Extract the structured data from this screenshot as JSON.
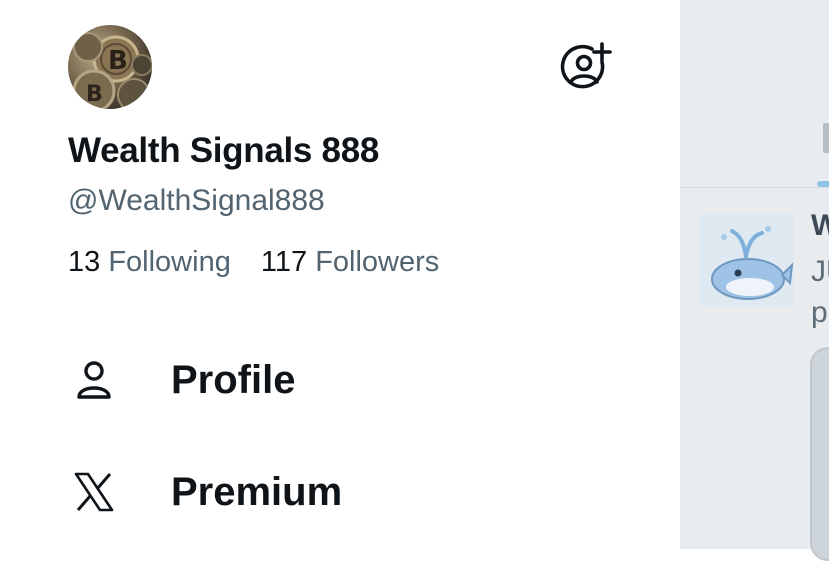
{
  "account": {
    "display_name": "Wealth Signals 888",
    "handle": "@WealthSignal888",
    "avatar_icon": "bitcoin-coins-avatar",
    "add_account_icon": "add-account-icon"
  },
  "stats": {
    "following_count": "13",
    "following_label": "Following",
    "followers_count": "117",
    "followers_label": "Followers"
  },
  "menu": [
    {
      "label": "Profile",
      "icon": "person-icon"
    },
    {
      "label": "Premium",
      "icon": "x-logo-icon"
    }
  ],
  "background_timeline": {
    "post_author_partial": "W",
    "post_line2_partial": "JU",
    "post_line3_partial": "p",
    "post_avatar_icon": "whale-avatar"
  },
  "colors": {
    "primary_text": "#0f1419",
    "secondary_text": "#536471",
    "overlay_dim": "#e8ecef",
    "accent": "#1d9bf0"
  }
}
